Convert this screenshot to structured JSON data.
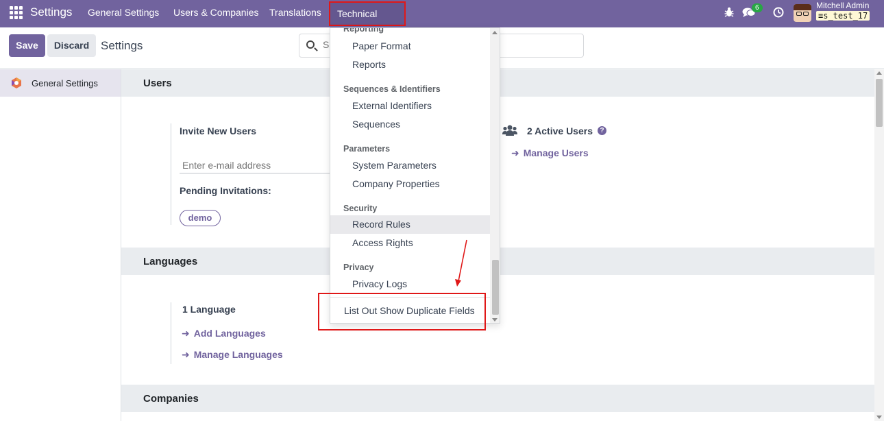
{
  "navbar": {
    "brand": "Settings",
    "menu": [
      "General Settings",
      "Users & Companies",
      "Translations",
      "Technical"
    ],
    "chat_badge": "6",
    "user_name": "Mitchell Admin",
    "database": "s_test_17",
    "icons": [
      "apps-icon",
      "bug-icon",
      "chat-icon",
      "clock-icon",
      "avatar"
    ]
  },
  "control": {
    "save_label": "Save",
    "discard_label": "Discard",
    "title": "Settings",
    "search_placeholder": "S"
  },
  "sidebar": {
    "items": [
      {
        "label": "General Settings"
      }
    ]
  },
  "sections": {
    "users": {
      "title": "Users",
      "invite_label": "Invite New Users",
      "email_placeholder": "Enter e-mail address",
      "pending_label": "Pending Invitations:",
      "pending_tags": [
        "demo"
      ],
      "active_users": "2 Active Users",
      "help": "?",
      "manage_users": "Manage Users"
    },
    "languages": {
      "title": "Languages",
      "count_label": "1 Language",
      "add_languages": "Add Languages",
      "manage_languages": "Manage Languages"
    },
    "companies": {
      "title": "Companies"
    }
  },
  "dropdown": {
    "partial_header": "Reporting",
    "items_reporting": [
      "Paper Format",
      "Reports"
    ],
    "sequences_header": "Sequences & Identifiers",
    "items_sequences": [
      "External Identifiers",
      "Sequences"
    ],
    "parameters_header": "Parameters",
    "items_parameters": [
      "System Parameters",
      "Company Properties"
    ],
    "security_header": "Security",
    "items_security": [
      "Record Rules",
      "Access Rights"
    ],
    "privacy_header": "Privacy",
    "items_privacy": [
      "Privacy Logs"
    ],
    "extra_item": "List Out Show Duplicate Fields",
    "active_item": "Record Rules"
  },
  "colors": {
    "brand": "#71639e",
    "annotation": "#e01818",
    "badge": "#28a745"
  }
}
